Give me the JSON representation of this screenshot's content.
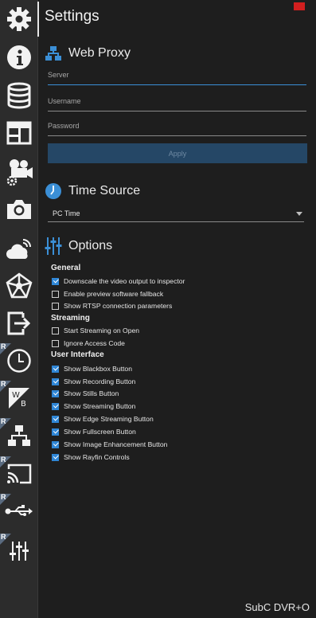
{
  "app": {
    "title": "Settings",
    "footer": "SubC DVR+O",
    "accent": "#2f86d6"
  },
  "sidebar": {
    "items": [
      {
        "name": "settings",
        "icon": "gear-icon",
        "active": true
      },
      {
        "name": "info",
        "icon": "info-icon"
      },
      {
        "name": "database",
        "icon": "database-icon"
      },
      {
        "name": "layout",
        "icon": "layout-icon"
      },
      {
        "name": "camera-settings",
        "icon": "video-camera-gear-icon"
      },
      {
        "name": "snapshot",
        "icon": "camera-icon"
      },
      {
        "name": "cloud",
        "icon": "cloud-wifi-icon"
      },
      {
        "name": "network",
        "icon": "network-star-icon"
      },
      {
        "name": "export",
        "icon": "export-icon"
      },
      {
        "name": "time",
        "icon": "clock-icon",
        "badge": "R"
      },
      {
        "name": "white-balance",
        "icon": "white-balance-icon",
        "badge": "R"
      },
      {
        "name": "network-proxy",
        "icon": "network-icon",
        "badge": "R"
      },
      {
        "name": "cast",
        "icon": "cast-icon",
        "badge": "R"
      },
      {
        "name": "usb",
        "icon": "usb-icon",
        "badge": "R"
      },
      {
        "name": "sliders",
        "icon": "sliders-icon",
        "badge": "R"
      }
    ],
    "badge_letter": "R"
  },
  "web_proxy": {
    "heading": "Web Proxy",
    "server_placeholder": "Server",
    "username_placeholder": "Username",
    "password_placeholder": "Password",
    "apply_label": "Apply"
  },
  "time_source": {
    "heading": "Time Source",
    "selected": "PC Time"
  },
  "options": {
    "heading": "Options",
    "general": {
      "title": "General",
      "items": [
        {
          "label": "Downscale the video output to inspector",
          "checked": true
        },
        {
          "label": "Enable preview software fallback",
          "checked": false
        },
        {
          "label": "Show RTSP connection parameters",
          "checked": false
        }
      ]
    },
    "streaming": {
      "title": "Streaming",
      "items": [
        {
          "label": "Start Streaming on Open",
          "checked": false
        },
        {
          "label": "Ignore Access Code",
          "checked": false
        }
      ]
    },
    "ui": {
      "title": "User Interface",
      "items": [
        {
          "label": "Show Blackbox Button",
          "checked": true
        },
        {
          "label": "Show Recording Button",
          "checked": true
        },
        {
          "label": "Show Stills Button",
          "checked": true
        },
        {
          "label": "Show Streaming Button",
          "checked": true
        },
        {
          "label": "Show Edge Streaming Button",
          "checked": true
        },
        {
          "label": "Show Fullscreen Button",
          "checked": true
        },
        {
          "label": "Show Image Enhancement Button",
          "checked": true
        },
        {
          "label": "Show Rayfin Controls",
          "checked": true
        }
      ]
    }
  }
}
